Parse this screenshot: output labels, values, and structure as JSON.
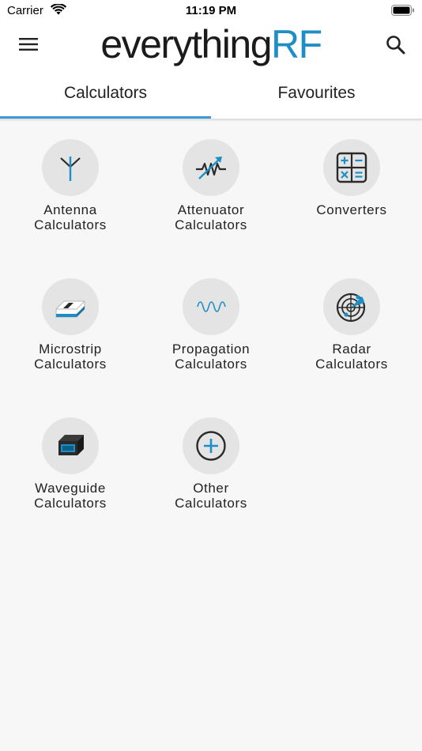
{
  "status_bar": {
    "carrier": "Carrier",
    "time": "11:19 PM"
  },
  "app_bar": {
    "logo_part1": "everything",
    "logo_part2": "RF"
  },
  "tabs": [
    {
      "label": "Calculators",
      "active": true
    },
    {
      "label": "Favourites",
      "active": false
    }
  ],
  "categories": [
    {
      "line1": "Antenna",
      "line2": "Calculators",
      "icon": "antenna-icon"
    },
    {
      "line1": "Attenuator",
      "line2": "Calculators",
      "icon": "attenuator-icon"
    },
    {
      "line1": "Converters",
      "line2": "",
      "icon": "calculator-icon"
    },
    {
      "line1": "Microstrip",
      "line2": "Calculators",
      "icon": "microstrip-icon"
    },
    {
      "line1": "Propagation",
      "line2": "Calculators",
      "icon": "wave-icon"
    },
    {
      "line1": "Radar",
      "line2": "Calculators",
      "icon": "radar-icon"
    },
    {
      "line1": "Waveguide",
      "line2": "Calculators",
      "icon": "waveguide-icon"
    },
    {
      "line1": "Other",
      "line2": "Calculators",
      "icon": "plus-circle-icon"
    }
  ],
  "colors": {
    "accent": "#1e8fc6",
    "tab_indicator": "#3c9ad7",
    "icon_bg": "#e4e4e4",
    "background": "#f7f7f7"
  }
}
